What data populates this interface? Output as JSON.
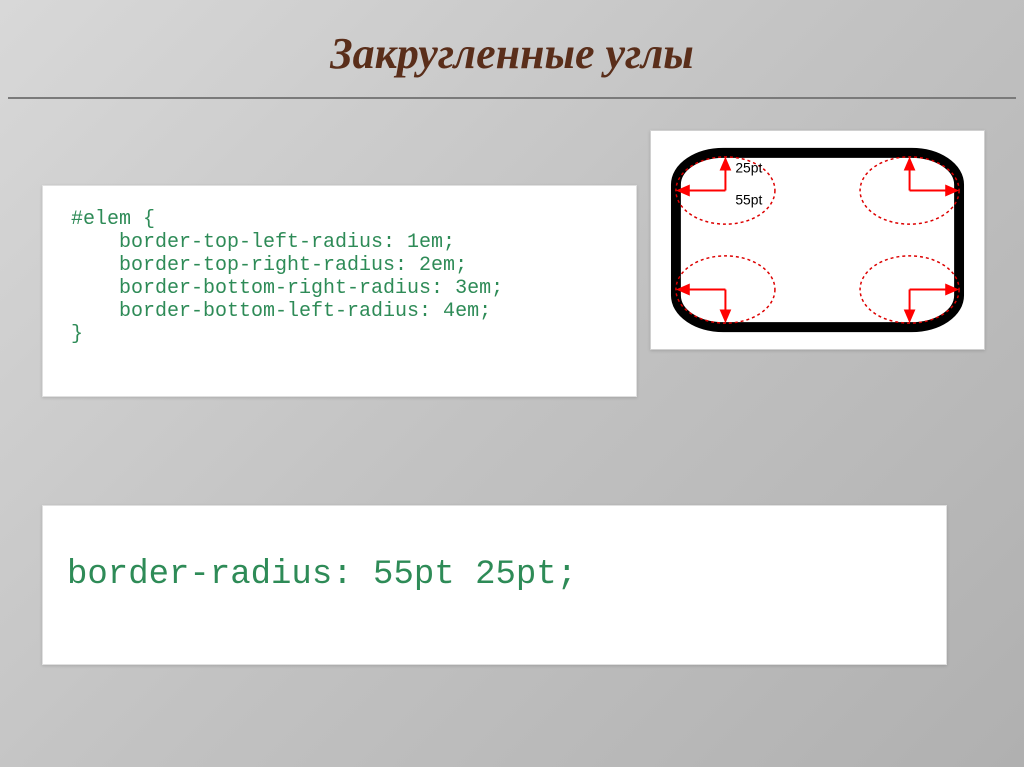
{
  "title": "Закругленные углы",
  "code1": "#elem {\n    border-top-left-radius: 1em;\n    border-top-right-radius: 2em;\n    border-bottom-right-radius: 3em;\n    border-bottom-left-radius: 4em;\n}",
  "code2": "border-radius: 55pt 25pt;",
  "diagram": {
    "label_top": "25pt",
    "label_left": "55pt"
  }
}
